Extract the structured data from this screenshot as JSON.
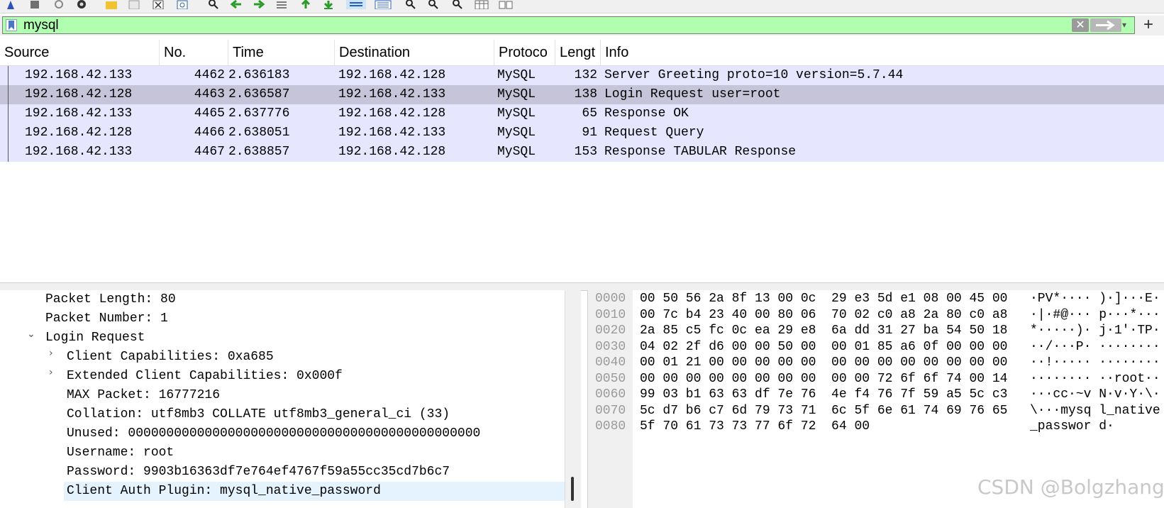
{
  "filter": {
    "value": "mysql"
  },
  "columns": [
    "Source",
    "No.",
    "Time",
    "Destination",
    "Protoco",
    "Lengt",
    "Info"
  ],
  "packets": [
    {
      "source": "192.168.42.133",
      "no": "4462",
      "time": "2.636183",
      "destination": "192.168.42.128",
      "protocol": "MySQL",
      "length": "132",
      "info": "Server Greeting  proto=10 version=5.7.44"
    },
    {
      "source": "192.168.42.128",
      "no": "4463",
      "time": "2.636587",
      "destination": "192.168.42.133",
      "protocol": "MySQL",
      "length": "138",
      "info": "Login Request user=root"
    },
    {
      "source": "192.168.42.133",
      "no": "4465",
      "time": "2.637776",
      "destination": "192.168.42.128",
      "protocol": "MySQL",
      "length": "65",
      "info": "Response  OK"
    },
    {
      "source": "192.168.42.128",
      "no": "4466",
      "time": "2.638051",
      "destination": "192.168.42.133",
      "protocol": "MySQL",
      "length": "91",
      "info": "Request Query"
    },
    {
      "source": "192.168.42.133",
      "no": "4467",
      "time": "2.638857",
      "destination": "192.168.42.128",
      "protocol": "MySQL",
      "length": "153",
      "info": "Response TABULAR Response"
    }
  ],
  "details": [
    {
      "text": "Packet Length: 80"
    },
    {
      "text": "Packet Number: 1"
    },
    {
      "text": "Login Request"
    },
    {
      "text": "Client Capabilities: 0xa685"
    },
    {
      "text": "Extended Client Capabilities: 0x000f"
    },
    {
      "text": "MAX Packet: 16777216"
    },
    {
      "text": "Collation: utf8mb3 COLLATE utf8mb3_general_ci (33)"
    },
    {
      "text": "Unused: 0000000000000000000000000000000000000000000000"
    },
    {
      "text": "Username: root"
    },
    {
      "text": "Password: 9903b16363df7e764ef4767f59a55cc35cd7b6c7"
    },
    {
      "text": "Client Auth Plugin: mysql_native_password"
    }
  ],
  "hex": [
    {
      "offset": "0000",
      "bytes": "00 50 56 2a 8f 13 00 0c  29 e3 5d e1 08 00 45 00",
      "ascii": "·PV*···· )·]···E·"
    },
    {
      "offset": "0010",
      "bytes": "00 7c b4 23 40 00 80 06  70 02 c0 a8 2a 80 c0 a8",
      "ascii": "·|·#@··· p···*···"
    },
    {
      "offset": "0020",
      "bytes": "2a 85 c5 fc 0c ea 29 e8  6a dd 31 27 ba 54 50 18",
      "ascii": "*·····)· j·1'·TP·"
    },
    {
      "offset": "0030",
      "bytes": "04 02 2f d6 00 00 50 00  00 01 85 a6 0f 00 00 00",
      "ascii": "··/···P· ········"
    },
    {
      "offset": "0040",
      "bytes": "00 01 21 00 00 00 00 00  00 00 00 00 00 00 00 00",
      "ascii": "··!····· ········"
    },
    {
      "offset": "0050",
      "bytes": "00 00 00 00 00 00 00 00  00 00 72 6f 6f 74 00 14",
      "ascii": "········ ··root··"
    },
    {
      "offset": "0060",
      "bytes": "99 03 b1 63 63 df 7e 76  4e f4 76 7f 59 a5 5c c3",
      "ascii": "···cc·~v N·v·Y·\\·"
    },
    {
      "offset": "0070",
      "bytes": "5c d7 b6 c7 6d 79 73 71  6c 5f 6e 61 74 69 76 65",
      "ascii": "\\···mysq l_native"
    },
    {
      "offset": "0080",
      "bytes": "5f 70 61 73 73 77 6f 72  64 00",
      "ascii": "_passwor d·"
    }
  ],
  "watermark": "CSDN @Bolgzhang",
  "colors": {
    "filter_bg": "#afffaf",
    "row_bg": "#e7e6ff",
    "row_selected": "#c5c4d8",
    "detail_highlight": "#e5f3ff"
  }
}
